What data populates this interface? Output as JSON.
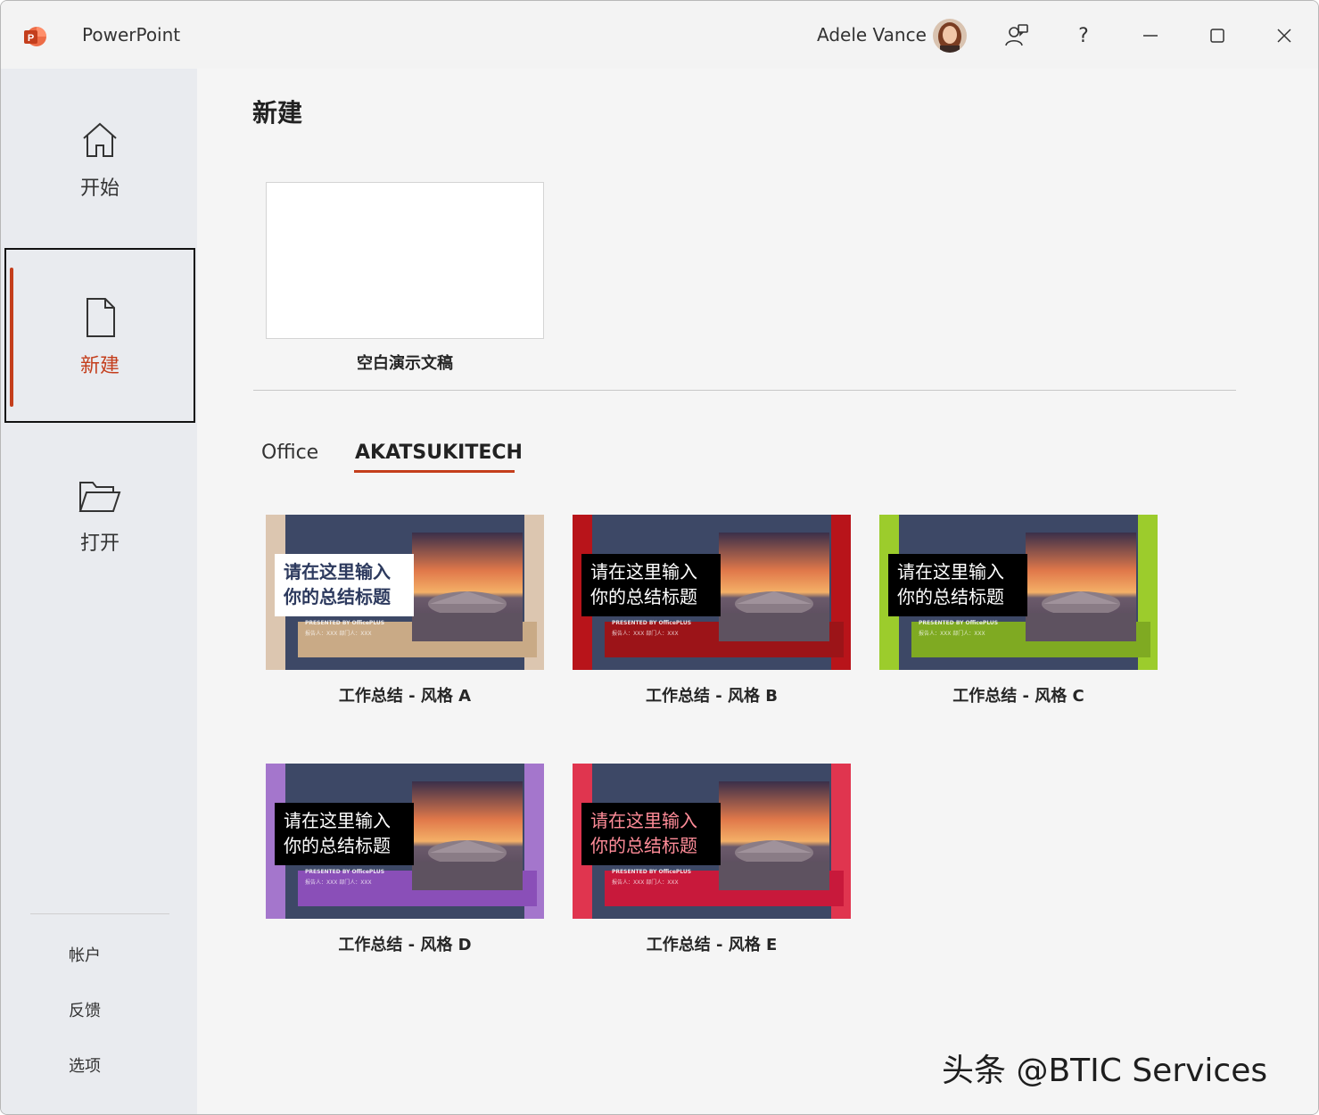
{
  "titlebar": {
    "app_name": "PowerPoint",
    "user_name": "Adele Vance",
    "icons": [
      "powerpoint-logo-icon",
      "user-avatar",
      "feedback-person-icon",
      "help-icon",
      "minimize-icon",
      "maximize-icon",
      "close-icon"
    ],
    "help_label": "?"
  },
  "sidebar": {
    "items": [
      {
        "label": "开始",
        "icon": "home-icon"
      },
      {
        "label": "新建",
        "icon": "new-document-icon",
        "selected": true
      },
      {
        "label": "打开",
        "icon": "open-folder-icon"
      }
    ],
    "bottom_links": [
      {
        "label": "帐户"
      },
      {
        "label": "反馈"
      },
      {
        "label": "选项"
      }
    ]
  },
  "main": {
    "title": "新建",
    "blank": {
      "label": "空白演示文稿"
    },
    "tabs": [
      {
        "label": "Office",
        "active": false
      },
      {
        "label": "AKATSUKITECH",
        "active": true
      }
    ],
    "templates": [
      {
        "label": "工作总结 - 风格 A",
        "title_line1": "请在这里输入",
        "title_line2": "你的总结标题",
        "presented": "PRESENTED BY OfficePLUS",
        "meta": "报告人：XXX  部门人：XXX",
        "accent": "#c9aa86",
        "side": "#dcc6b0",
        "style": "light"
      },
      {
        "label": "工作总结 - 风格 B",
        "title_line1": "请在这里输入",
        "title_line2": "你的总结标题",
        "presented": "PRESENTED BY OfficePLUS",
        "meta": "报告人：XXX  部门人：XXX",
        "accent": "#9c1418",
        "side": "#b8141a",
        "style": "dark"
      },
      {
        "label": "工作总结 - 风格 C",
        "title_line1": "请在这里输入",
        "title_line2": "你的总结标题",
        "presented": "PRESENTED BY OfficePLUS",
        "meta": "报告人：XXX  部门人：XXX",
        "accent": "#7faa22",
        "side": "#9ccc2c",
        "style": "dark"
      },
      {
        "label": "工作总结 - 风格 D",
        "title_line1": "请在这里输入",
        "title_line2": "你的总结标题",
        "presented": "PRESENTED BY OfficePLUS",
        "meta": "报告人：XXX  部门人：XXX",
        "accent": "#8a4fb8",
        "side": "#a476cc",
        "style": "dark"
      },
      {
        "label": "工作总结 - 风格 E",
        "title_line1": "请在这里输入",
        "title_line2": "你的总结标题",
        "presented": "PRESENTED BY OfficePLUS",
        "meta": "报告人：XXX  部门人：XXX",
        "accent": "#c8193b",
        "side": "#e0354f",
        "style": "pink"
      }
    ]
  },
  "watermark": "头条 @BTIC Services",
  "colors": {
    "accent": "#c43e1c",
    "sidebar_bg": "#e9ebef",
    "main_bg": "#f5f5f5",
    "thumb_base": "#3d4866"
  }
}
